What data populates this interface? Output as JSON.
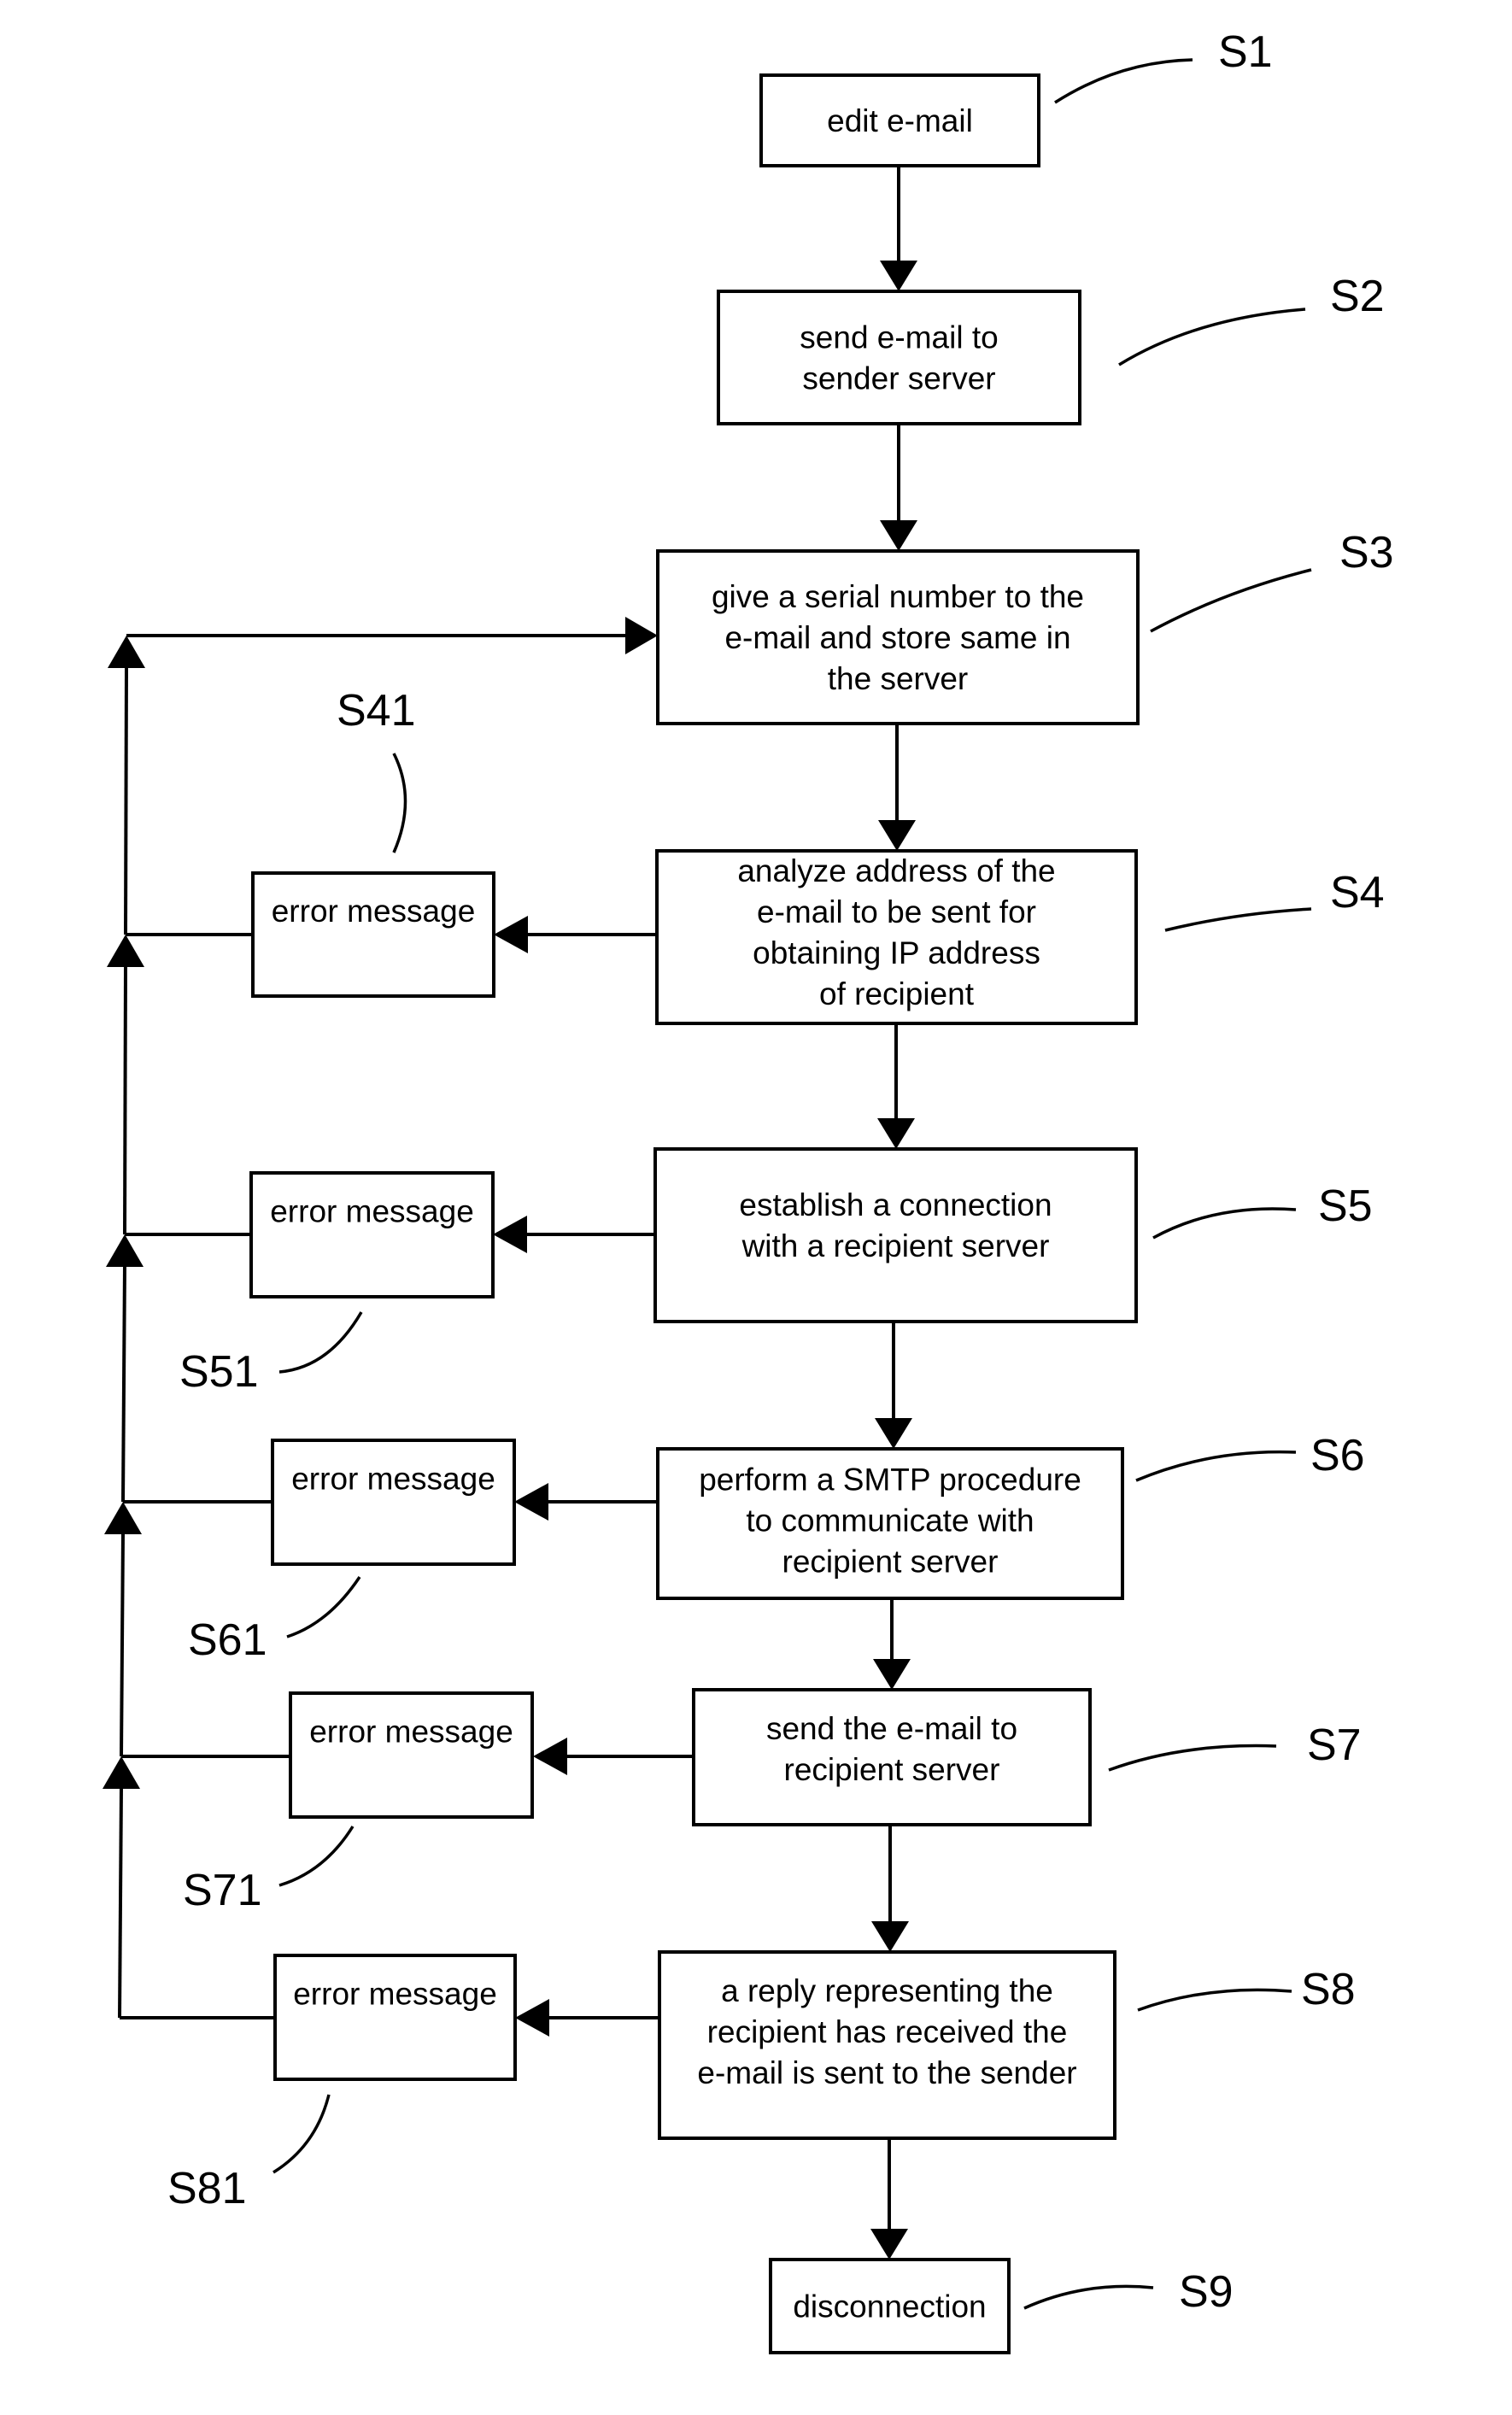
{
  "diagram": {
    "type": "flowchart",
    "steps": [
      {
        "id": "S1",
        "label": "S1",
        "lines": [
          "edit e-mail"
        ]
      },
      {
        "id": "S2",
        "label": "S2",
        "lines": [
          "send e-mail to",
          "sender server"
        ]
      },
      {
        "id": "S3",
        "label": "S3",
        "lines": [
          "give a serial number to the",
          "e-mail and store same in",
          "the server"
        ]
      },
      {
        "id": "S4",
        "label": "S4",
        "lines": [
          "analyze address of the",
          "e-mail to be sent for",
          "obtaining IP address",
          "of recipient"
        ]
      },
      {
        "id": "S5",
        "label": "S5",
        "lines": [
          "establish a connection",
          "with a recipient server"
        ]
      },
      {
        "id": "S6",
        "label": "S6",
        "lines": [
          "perform a SMTP procedure",
          "to communicate with",
          "recipient server"
        ]
      },
      {
        "id": "S7",
        "label": "S7",
        "lines": [
          "send the e-mail to",
          "recipient server"
        ]
      },
      {
        "id": "S8",
        "label": "S8",
        "lines": [
          "a reply representing the",
          "recipient has received the",
          "e-mail is sent to the sender"
        ]
      },
      {
        "id": "S9",
        "label": "S9",
        "lines": [
          "disconnection"
        ]
      }
    ],
    "errors": [
      {
        "id": "S41",
        "label": "S41",
        "text": "error message",
        "from": "S4"
      },
      {
        "id": "S51",
        "label": "S51",
        "text": "error message",
        "from": "S5"
      },
      {
        "id": "S61",
        "label": "S61",
        "text": "error message",
        "from": "S6"
      },
      {
        "id": "S71",
        "label": "S71",
        "text": "error message",
        "from": "S7"
      },
      {
        "id": "S81",
        "label": "S81",
        "text": "error message",
        "from": "S8"
      }
    ],
    "flow": [
      [
        "S1",
        "S2"
      ],
      [
        "S2",
        "S3"
      ],
      [
        "S3",
        "S4"
      ],
      [
        "S4",
        "S5"
      ],
      [
        "S5",
        "S6"
      ],
      [
        "S6",
        "S7"
      ],
      [
        "S7",
        "S8"
      ],
      [
        "S8",
        "S9"
      ],
      [
        "S4",
        "S41"
      ],
      [
        "S5",
        "S51"
      ],
      [
        "S6",
        "S61"
      ],
      [
        "S7",
        "S71"
      ],
      [
        "S8",
        "S81"
      ],
      [
        "S41",
        "S3"
      ],
      [
        "S51",
        "S3"
      ],
      [
        "S61",
        "S3"
      ],
      [
        "S71",
        "S3"
      ],
      [
        "S81",
        "S3"
      ]
    ]
  }
}
